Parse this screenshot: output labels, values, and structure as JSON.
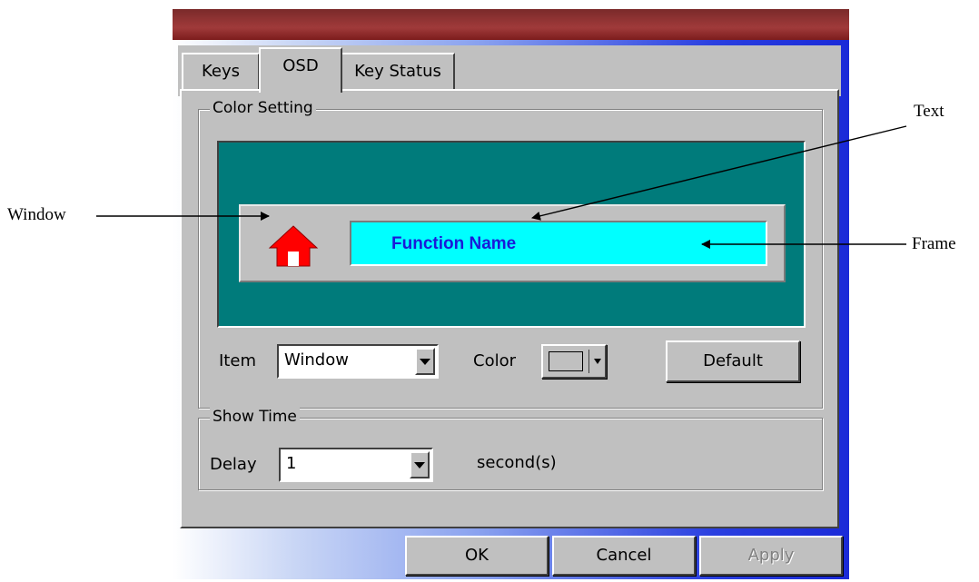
{
  "tabs": [
    {
      "label": "Keys"
    },
    {
      "label": "OSD"
    },
    {
      "label": "Key Status"
    }
  ],
  "color_setting": {
    "title": "Color Setting",
    "preview": {
      "icon": "home-icon",
      "function_name": "Function Name"
    },
    "item_label": "Item",
    "item_value": "Window",
    "color_label": "Color",
    "default_button": "Default"
  },
  "show_time": {
    "title": "Show Time",
    "delay_label": "Delay",
    "delay_value": "1",
    "unit": "second(s)"
  },
  "buttons": {
    "ok": "OK",
    "cancel": "Cancel",
    "apply": "Apply"
  },
  "annotations": {
    "window": "Window",
    "text": "Text",
    "frame": "Frame"
  },
  "colors": {
    "preview_bg": "#007b7b",
    "frame": "#00ffff",
    "text": "#1a1ad8",
    "icon": "#ff0000"
  }
}
